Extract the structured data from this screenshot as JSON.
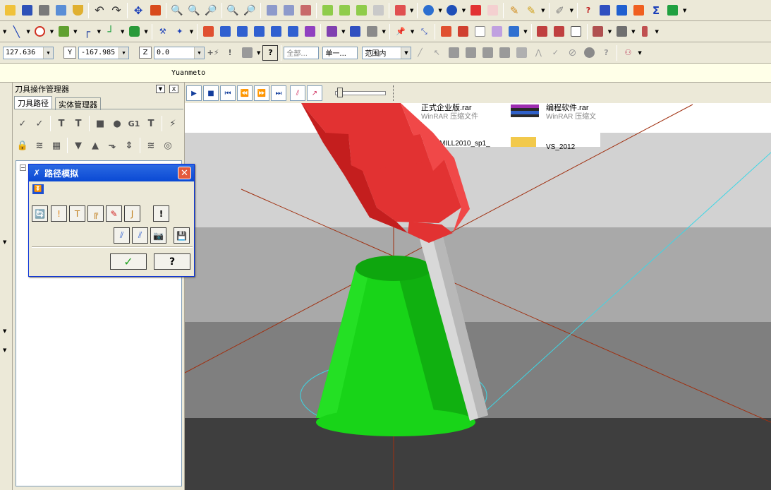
{
  "window": {
    "title": "Yuanmeto"
  },
  "coords": {
    "x_value": "127.636",
    "y_label": "Y",
    "y_value": "-167.985",
    "z_label": "Z",
    "z_value": "0.0",
    "filter_all": "全部...",
    "filter_single": "单一...",
    "range_select": "范围内"
  },
  "panel": {
    "title": "刀具操作管理器",
    "close_label": "X",
    "tabs": [
      "刀具路径",
      "实体管理器"
    ],
    "tree_toggle": "−"
  },
  "playback": {
    "buttons": [
      "play",
      "stop",
      "first",
      "prev",
      "next",
      "last"
    ]
  },
  "dialog": {
    "title": "路径模拟",
    "ok_label": "✓",
    "help_label": "?"
  },
  "desktop_files": [
    {
      "name": "正式企业版.rar",
      "type": "WinRAR 压缩文件"
    },
    {
      "name": "编程软件.rar",
      "type": "WinRAR 压缩文"
    },
    {
      "name": "hyperMILL2010_sp1_",
      "type": ""
    },
    {
      "name": "VS_2012",
      "type": ""
    }
  ],
  "colors": {
    "toolbar_bg": "#ECE9D8",
    "tool_holder": "#E23232",
    "part": "#18D418",
    "toolpath": "#3CD7E6",
    "axis": "#A03010",
    "title_bar": "#0A49D4"
  }
}
